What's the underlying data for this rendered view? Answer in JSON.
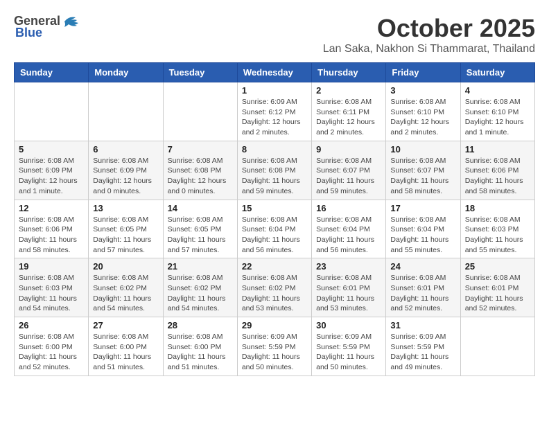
{
  "header": {
    "logo_general": "General",
    "logo_blue": "Blue",
    "month_title": "October 2025",
    "location": "Lan Saka, Nakhon Si Thammarat, Thailand"
  },
  "weekdays": [
    "Sunday",
    "Monday",
    "Tuesday",
    "Wednesday",
    "Thursday",
    "Friday",
    "Saturday"
  ],
  "weeks": [
    [
      {
        "day": "",
        "info": ""
      },
      {
        "day": "",
        "info": ""
      },
      {
        "day": "",
        "info": ""
      },
      {
        "day": "1",
        "info": "Sunrise: 6:09 AM\nSunset: 6:12 PM\nDaylight: 12 hours\nand 2 minutes."
      },
      {
        "day": "2",
        "info": "Sunrise: 6:08 AM\nSunset: 6:11 PM\nDaylight: 12 hours\nand 2 minutes."
      },
      {
        "day": "3",
        "info": "Sunrise: 6:08 AM\nSunset: 6:10 PM\nDaylight: 12 hours\nand 2 minutes."
      },
      {
        "day": "4",
        "info": "Sunrise: 6:08 AM\nSunset: 6:10 PM\nDaylight: 12 hours\nand 1 minute."
      }
    ],
    [
      {
        "day": "5",
        "info": "Sunrise: 6:08 AM\nSunset: 6:09 PM\nDaylight: 12 hours\nand 1 minute."
      },
      {
        "day": "6",
        "info": "Sunrise: 6:08 AM\nSunset: 6:09 PM\nDaylight: 12 hours\nand 0 minutes."
      },
      {
        "day": "7",
        "info": "Sunrise: 6:08 AM\nSunset: 6:08 PM\nDaylight: 12 hours\nand 0 minutes."
      },
      {
        "day": "8",
        "info": "Sunrise: 6:08 AM\nSunset: 6:08 PM\nDaylight: 11 hours\nand 59 minutes."
      },
      {
        "day": "9",
        "info": "Sunrise: 6:08 AM\nSunset: 6:07 PM\nDaylight: 11 hours\nand 59 minutes."
      },
      {
        "day": "10",
        "info": "Sunrise: 6:08 AM\nSunset: 6:07 PM\nDaylight: 11 hours\nand 58 minutes."
      },
      {
        "day": "11",
        "info": "Sunrise: 6:08 AM\nSunset: 6:06 PM\nDaylight: 11 hours\nand 58 minutes."
      }
    ],
    [
      {
        "day": "12",
        "info": "Sunrise: 6:08 AM\nSunset: 6:06 PM\nDaylight: 11 hours\nand 58 minutes."
      },
      {
        "day": "13",
        "info": "Sunrise: 6:08 AM\nSunset: 6:05 PM\nDaylight: 11 hours\nand 57 minutes."
      },
      {
        "day": "14",
        "info": "Sunrise: 6:08 AM\nSunset: 6:05 PM\nDaylight: 11 hours\nand 57 minutes."
      },
      {
        "day": "15",
        "info": "Sunrise: 6:08 AM\nSunset: 6:04 PM\nDaylight: 11 hours\nand 56 minutes."
      },
      {
        "day": "16",
        "info": "Sunrise: 6:08 AM\nSunset: 6:04 PM\nDaylight: 11 hours\nand 56 minutes."
      },
      {
        "day": "17",
        "info": "Sunrise: 6:08 AM\nSunset: 6:04 PM\nDaylight: 11 hours\nand 55 minutes."
      },
      {
        "day": "18",
        "info": "Sunrise: 6:08 AM\nSunset: 6:03 PM\nDaylight: 11 hours\nand 55 minutes."
      }
    ],
    [
      {
        "day": "19",
        "info": "Sunrise: 6:08 AM\nSunset: 6:03 PM\nDaylight: 11 hours\nand 54 minutes."
      },
      {
        "day": "20",
        "info": "Sunrise: 6:08 AM\nSunset: 6:02 PM\nDaylight: 11 hours\nand 54 minutes."
      },
      {
        "day": "21",
        "info": "Sunrise: 6:08 AM\nSunset: 6:02 PM\nDaylight: 11 hours\nand 54 minutes."
      },
      {
        "day": "22",
        "info": "Sunrise: 6:08 AM\nSunset: 6:02 PM\nDaylight: 11 hours\nand 53 minutes."
      },
      {
        "day": "23",
        "info": "Sunrise: 6:08 AM\nSunset: 6:01 PM\nDaylight: 11 hours\nand 53 minutes."
      },
      {
        "day": "24",
        "info": "Sunrise: 6:08 AM\nSunset: 6:01 PM\nDaylight: 11 hours\nand 52 minutes."
      },
      {
        "day": "25",
        "info": "Sunrise: 6:08 AM\nSunset: 6:01 PM\nDaylight: 11 hours\nand 52 minutes."
      }
    ],
    [
      {
        "day": "26",
        "info": "Sunrise: 6:08 AM\nSunset: 6:00 PM\nDaylight: 11 hours\nand 52 minutes."
      },
      {
        "day": "27",
        "info": "Sunrise: 6:08 AM\nSunset: 6:00 PM\nDaylight: 11 hours\nand 51 minutes."
      },
      {
        "day": "28",
        "info": "Sunrise: 6:08 AM\nSunset: 6:00 PM\nDaylight: 11 hours\nand 51 minutes."
      },
      {
        "day": "29",
        "info": "Sunrise: 6:09 AM\nSunset: 5:59 PM\nDaylight: 11 hours\nand 50 minutes."
      },
      {
        "day": "30",
        "info": "Sunrise: 6:09 AM\nSunset: 5:59 PM\nDaylight: 11 hours\nand 50 minutes."
      },
      {
        "day": "31",
        "info": "Sunrise: 6:09 AM\nSunset: 5:59 PM\nDaylight: 11 hours\nand 49 minutes."
      },
      {
        "day": "",
        "info": ""
      }
    ]
  ]
}
